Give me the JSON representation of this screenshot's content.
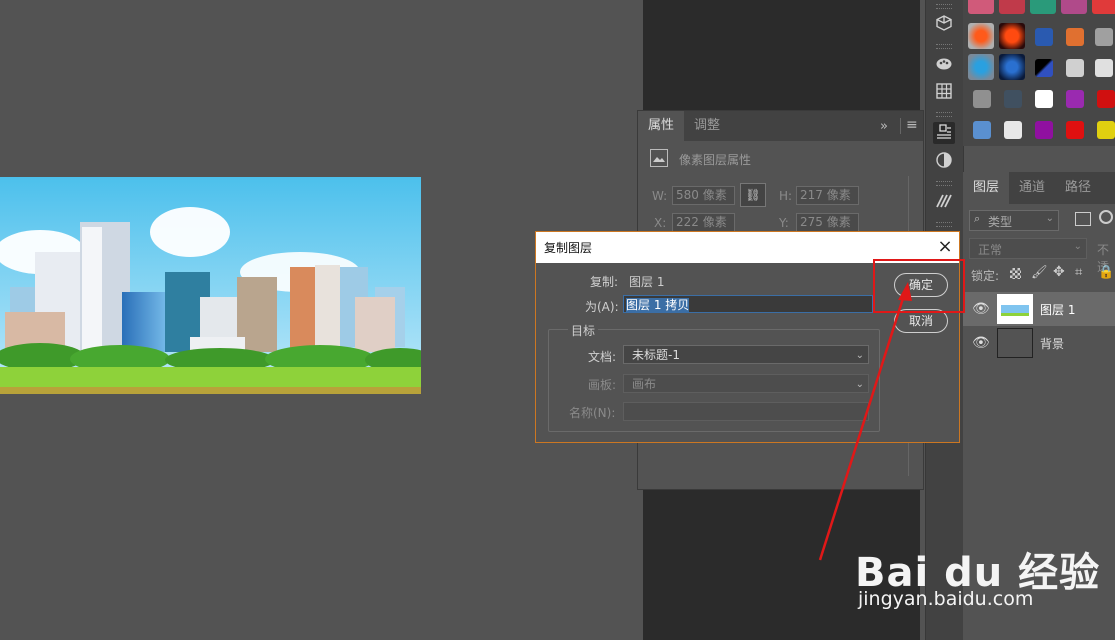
{
  "canvas": {
    "image": "city-skyline-illustration"
  },
  "properties_panel": {
    "tabs": [
      "属性",
      "调整"
    ],
    "collapse_icon": "double-chevron-right-icon",
    "menu_icon": "hamburger-icon",
    "heading": "像素图层属性",
    "heading_icon": "image-layer-icon",
    "w_label": "W:",
    "w_value": "580 像素",
    "h_label": "H:",
    "h_value": "217 像素",
    "x_label": "X:",
    "x_value": "222 像素",
    "y_label": "Y:",
    "y_value": "275 像素",
    "link_icon": "link-icon"
  },
  "tool_strip": {
    "icons": [
      "cube-icon",
      "palette-icon",
      "grid-icon",
      "properties-icon",
      "adjust-icon",
      "brush-settings-icon"
    ]
  },
  "styles_panel": {
    "swatch_colors": [
      "#d05a7a",
      "#c03a4a",
      "#2a9a7a",
      "#b04a8a",
      "#e03a3a",
      "#2a5ab0",
      "#e07030",
      "#a0a0a0",
      "#2aa0e0",
      "#2a70d0",
      "#3050c0",
      "#d0d0d0",
      "#e0e0e0",
      "#909090",
      "#405060",
      "#ffffff",
      "#9a2ab0",
      "#d01010",
      "#5a90d0",
      "#e8e8e8",
      "#9010a0",
      "#e01010",
      "#e0d010"
    ]
  },
  "layers_panel": {
    "tabs": [
      "图层",
      "通道",
      "路径"
    ],
    "filter_label": "类型",
    "blend_mode": "正常",
    "opacity_label": "不透",
    "lock_label": "锁定:",
    "layers": [
      {
        "name": "图层 1",
        "visible": true,
        "selected": true
      },
      {
        "name": "背景",
        "visible": true,
        "selected": false
      }
    ]
  },
  "dialog": {
    "title": "复制图层",
    "source_label": "复制:",
    "source_value": "图层 1",
    "as_label": "为(A):",
    "as_value": "图层 1 拷贝",
    "target_group_label": "目标",
    "document_label": "文档:",
    "document_value": "未标题-1",
    "artboard_label": "画板:",
    "artboard_value": "画布",
    "name_label": "名称(N):",
    "name_value": "",
    "ok_label": "确定",
    "cancel_label": "取消"
  },
  "watermark": {
    "logo_text": "Bai du 经验",
    "url": "jingyan.baidu.com"
  },
  "colors": {
    "workspace": "#535353",
    "dialog_border": "#cc7722",
    "selection": "#3b6ea5",
    "annotation_red": "#e01818"
  }
}
